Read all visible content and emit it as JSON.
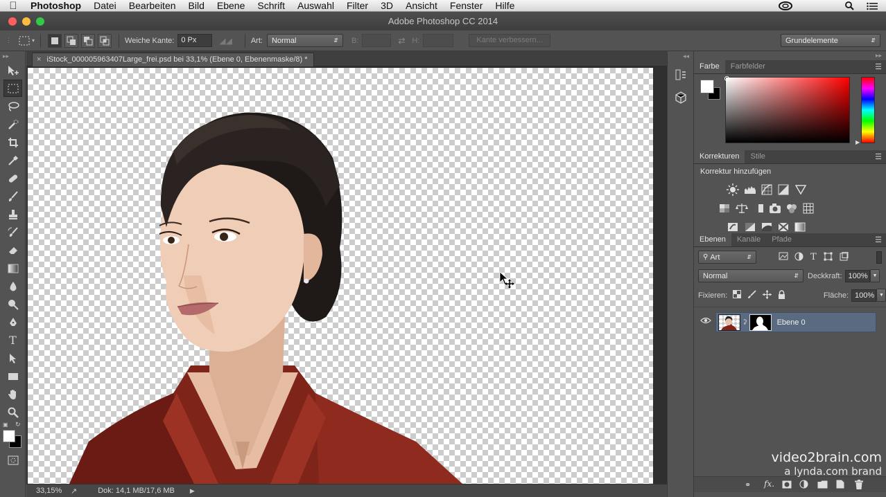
{
  "menubar": {
    "app_name": "Photoshop",
    "items": [
      "Datei",
      "Bearbeiten",
      "Bild",
      "Ebene",
      "Schrift",
      "Auswahl",
      "Filter",
      "3D",
      "Ansicht",
      "Fenster",
      "Hilfe"
    ]
  },
  "window": {
    "title": "Adobe Photoshop CC 2014"
  },
  "options_bar": {
    "feather_label": "Weiche Kante:",
    "feather_value": "0 Px",
    "style_label": "Art:",
    "style_value": "Normal",
    "width_label": "B:",
    "height_label": "H:",
    "refine_edge_label": "Kante verbessern...",
    "workspace_value": "Grundelemente"
  },
  "document": {
    "tab_title": "iStock_000005963407Large_frei.psd bei 33,1% (Ebene 0, Ebenenmaske/8) *",
    "zoom": "33,15%",
    "doc_size": "Dok: 14,1 MB/17,6 MB"
  },
  "color_panel": {
    "tabs": [
      "Farbe",
      "Farbfelder"
    ]
  },
  "adjustments_panel": {
    "tabs": [
      "Korrekturen",
      "Stile"
    ],
    "title": "Korrektur hinzufügen"
  },
  "layers_panel": {
    "tabs": [
      "Ebenen",
      "Kanäle",
      "Pfade"
    ],
    "filter_kind": "Art",
    "blend_mode": "Normal",
    "opacity_label": "Deckkraft:",
    "opacity_value": "100%",
    "lock_label": "Fixieren:",
    "fill_label": "Fläche:",
    "fill_value": "100%",
    "layers": [
      {
        "name": "Ebene 0"
      }
    ]
  },
  "watermark": {
    "line1": "video2brain.com",
    "line2": "a lynda.com brand"
  },
  "colors": {
    "accent_selected_layer": "#5a6a80",
    "traffic_red": "#fc605c",
    "traffic_yellow": "#fdbc40",
    "traffic_green": "#34c84a"
  }
}
